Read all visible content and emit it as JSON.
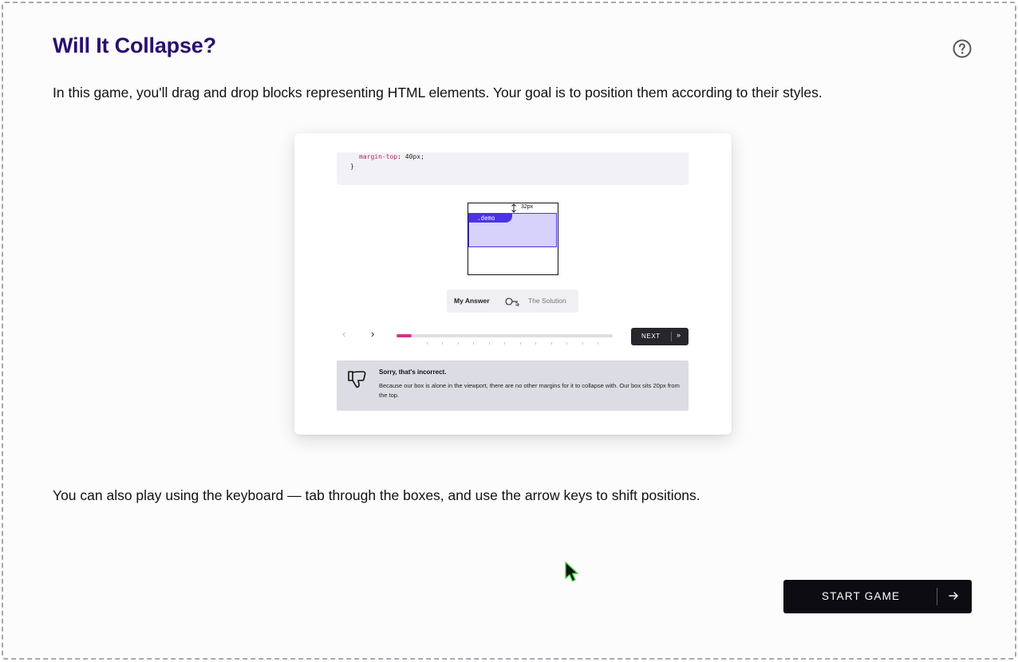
{
  "page": {
    "title": "Will It Collapse?",
    "intro": "In this game, you'll drag and drop blocks representing HTML elements. Your goal is to position them according to their styles.",
    "keyboard_note": "You can also play using the keyboard — tab through the boxes, and use the arrow keys to shift positions.",
    "help_icon": "question-circle-icon",
    "accent_color": "#2a0f6e"
  },
  "demo": {
    "code_property": "margin-top",
    "code_value": ": 40px;",
    "code_close": "}",
    "margin_label": "32px",
    "block_label": ".demo",
    "toggle": {
      "my_answer": "My Answer",
      "solution": "The Solution"
    },
    "progress_fraction": 0.07,
    "next_label": "NEXT",
    "next_arrows": "»",
    "feedback": {
      "title": "Sorry, that's incorrect.",
      "body": "Because our box is alone in the viewport, there are no other margins for it to collapse with. Our box sits 20px from the top."
    }
  },
  "start_button": {
    "label": "START GAME",
    "icon": "arrow-right-icon"
  }
}
